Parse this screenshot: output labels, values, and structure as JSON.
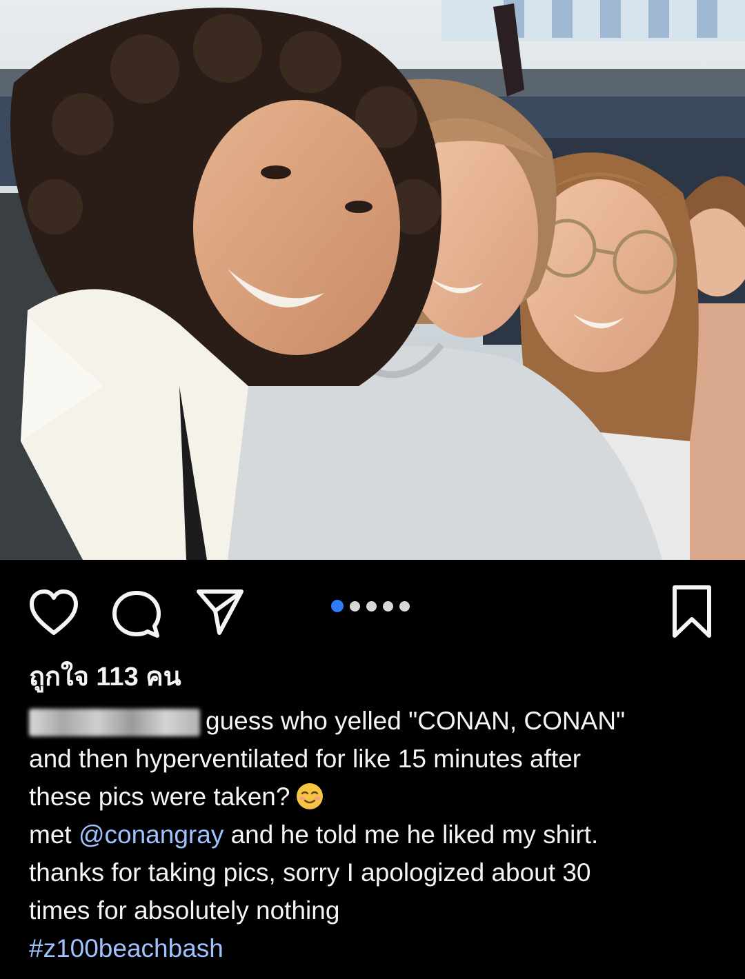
{
  "post": {
    "likes_text": "ถูกใจ 113 คน",
    "carousel": {
      "total": 5,
      "active_index": 0
    },
    "caption": {
      "line1_text": "guess who yelled \"CONAN, CONAN\"",
      "line2": "and then hyperventilated for like 15 minutes after",
      "line3": "these pics were taken?",
      "line3_emoji": "relieved-face-emoji",
      "line4_prefix": "met ",
      "line4_mention": "@conangray",
      "line4_suffix": " and he told me he liked my shirt.",
      "line5": "thanks for taking pics, sorry I apologized about 30",
      "line6": "times for absolutely nothing",
      "hashtag": "#z100beachbash"
    },
    "icons": {
      "like": "heart-outline-icon",
      "comment": "comment-bubble-icon",
      "share": "paper-plane-icon",
      "save": "bookmark-outline-icon"
    }
  },
  "colors": {
    "background": "#000000",
    "text": "#f5f5f5",
    "accent_dot": "#2e7cf6",
    "link": "#9fc3ff"
  }
}
